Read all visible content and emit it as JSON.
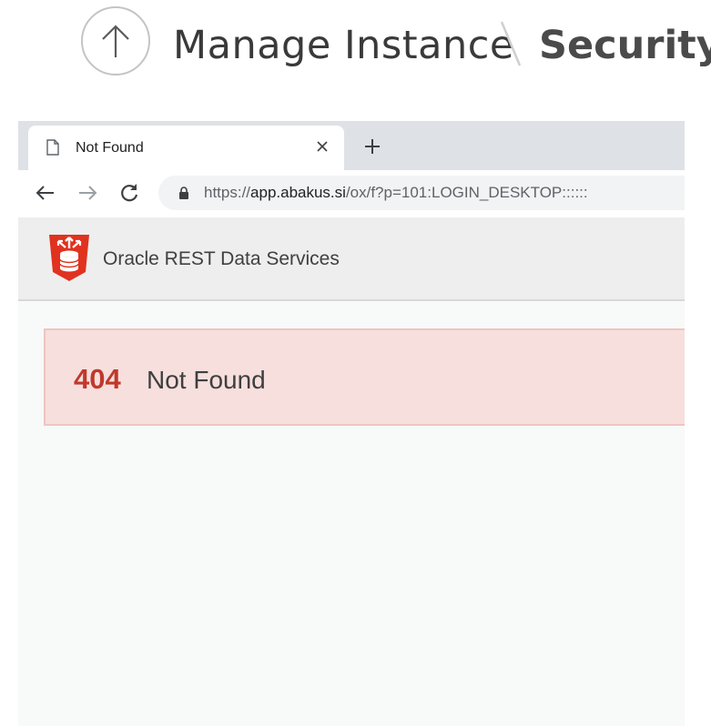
{
  "breadcrumb": {
    "parent": "Manage Instance",
    "current": "Security"
  },
  "browser": {
    "tab": {
      "title": "Not Found"
    },
    "address": {
      "scheme": "https://",
      "host": "app.abakus.si",
      "path": "/ox/f?p=101:LOGIN_DESKTOP::::::"
    }
  },
  "ords": {
    "title": "Oracle REST Data Services"
  },
  "error": {
    "code": "404",
    "message": "Not Found"
  },
  "colors": {
    "error_code": "#c0392b",
    "alert_bg": "#f6dfdd",
    "logo_red": "#e0321f"
  },
  "icons": [
    "up-arrow-icon",
    "page-icon",
    "close-icon",
    "plus-icon",
    "back-arrow-icon",
    "forward-arrow-icon",
    "reload-icon",
    "lock-icon",
    "ords-logo-icon"
  ]
}
